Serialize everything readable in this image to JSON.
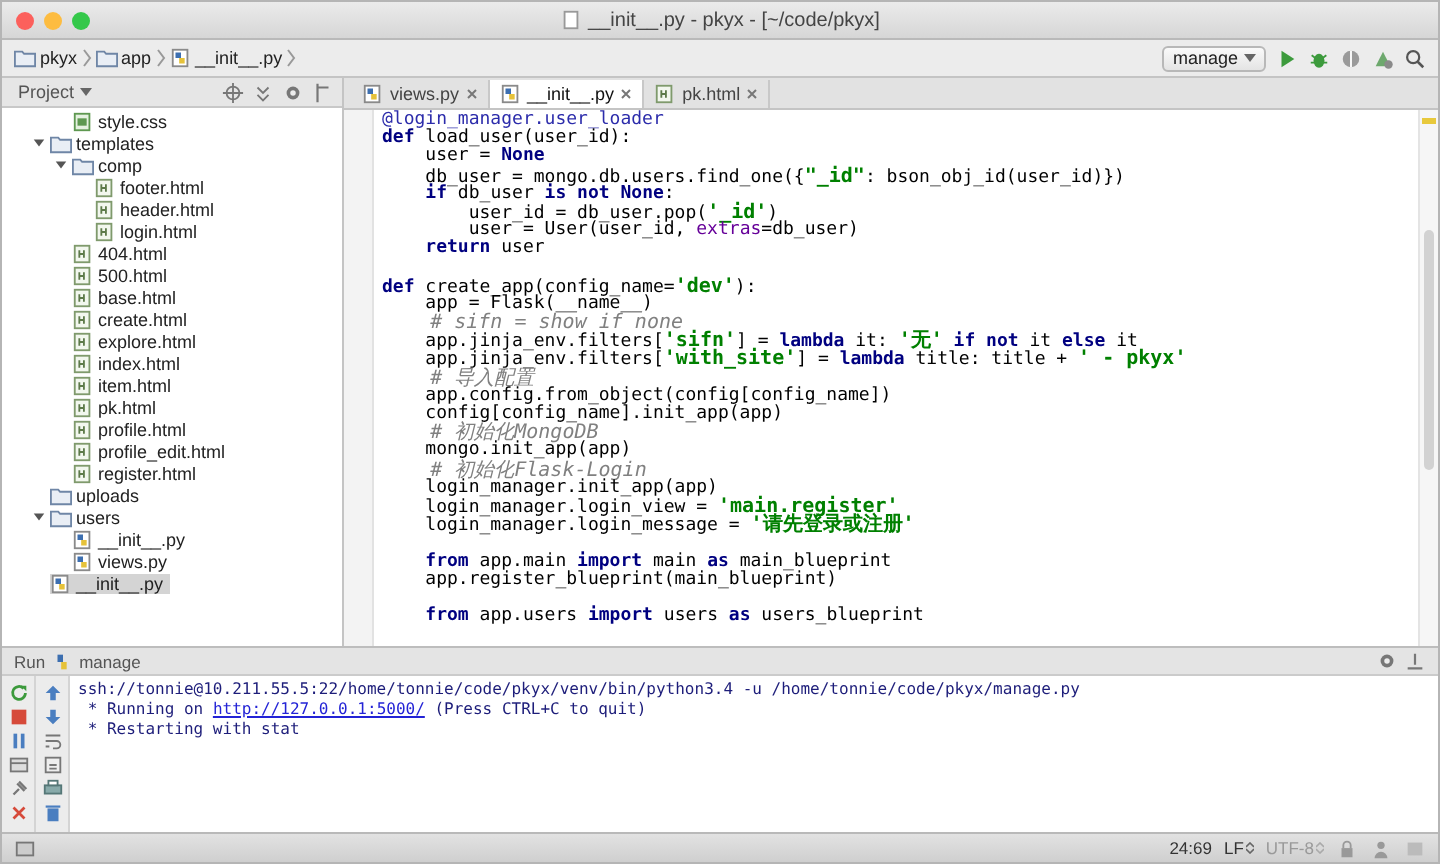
{
  "window": {
    "title": "__init__.py - pkyx - [~/code/pkyx]"
  },
  "breadcrumbs": [
    {
      "label": "pkyx",
      "kind": "folder"
    },
    {
      "label": "app",
      "kind": "folder"
    },
    {
      "label": "__init__.py",
      "kind": "py"
    }
  ],
  "run_config": {
    "label": "manage"
  },
  "project_panel": {
    "title": "Project",
    "tree": [
      {
        "children": [
          {
            "label": "style.css",
            "kind": "css",
            "selected": false
          }
        ]
      },
      {
        "label": "templates",
        "kind": "folder",
        "expanded": true,
        "selected": false,
        "children": [
          {
            "label": "comp",
            "kind": "folder",
            "expanded": true,
            "selected": false,
            "children": [
              {
                "label": "footer.html",
                "kind": "html",
                "selected": false
              },
              {
                "label": "header.html",
                "kind": "html",
                "selected": false
              },
              {
                "label": "login.html",
                "kind": "html",
                "selected": false
              }
            ]
          },
          {
            "label": "404.html",
            "kind": "html",
            "selected": false
          },
          {
            "label": "500.html",
            "kind": "html",
            "selected": false
          },
          {
            "label": "base.html",
            "kind": "html",
            "selected": false
          },
          {
            "label": "create.html",
            "kind": "html",
            "selected": false
          },
          {
            "label": "explore.html",
            "kind": "html",
            "selected": false
          },
          {
            "label": "index.html",
            "kind": "html",
            "selected": false
          },
          {
            "label": "item.html",
            "kind": "html",
            "selected": false
          },
          {
            "label": "pk.html",
            "kind": "html",
            "selected": false
          },
          {
            "label": "profile.html",
            "kind": "html",
            "selected": false
          },
          {
            "label": "profile_edit.html",
            "kind": "html",
            "selected": false
          },
          {
            "label": "register.html",
            "kind": "html",
            "selected": false
          }
        ]
      },
      {
        "label": "uploads",
        "kind": "folder",
        "selected": false
      },
      {
        "label": "users",
        "kind": "folder",
        "expanded": true,
        "selected": false,
        "children": [
          {
            "label": "__init__.py",
            "kind": "py",
            "selected": false
          },
          {
            "label": "views.py",
            "kind": "py",
            "selected": false
          }
        ]
      },
      {
        "label": "__init__.py",
        "kind": "py",
        "selected": true
      }
    ]
  },
  "editor_tabs": [
    {
      "label": "views.py",
      "kind": "py",
      "selected": false
    },
    {
      "label": "__init__.py",
      "kind": "py",
      "selected": true
    },
    {
      "label": "pk.html",
      "kind": "html",
      "selected": false
    }
  ],
  "code": [
    {
      "kind": "code",
      "tokens": [
        {
          "text": "@login_manager.user_loader",
          "kind": "deco"
        }
      ]
    },
    {
      "kind": "code",
      "tokens": [
        {
          "text": "def",
          "kind": "kw"
        },
        {
          "text": " load_user(user_id):",
          "kind": "plain"
        }
      ]
    },
    {
      "kind": "code",
      "tokens": [
        {
          "text": "    user = ",
          "kind": "plain"
        },
        {
          "text": "None",
          "kind": "kw"
        }
      ]
    },
    {
      "kind": "code",
      "tokens": [
        {
          "text": "    db_user = mongo.db.users.find_one({",
          "kind": "plain"
        },
        {
          "text": "\"_id\"",
          "kind": "str"
        },
        {
          "text": ": bson_obj_id(user_id)})",
          "kind": "plain"
        }
      ]
    },
    {
      "kind": "code",
      "tokens": [
        {
          "text": "    if",
          "kind": "kw"
        },
        {
          "text": " db_user ",
          "kind": "plain"
        },
        {
          "text": "is not None",
          "kind": "kw"
        },
        {
          "text": ":",
          "kind": "plain"
        }
      ]
    },
    {
      "kind": "code",
      "tokens": [
        {
          "text": "        user_id = db_user.pop(",
          "kind": "plain"
        },
        {
          "text": "'_id'",
          "kind": "str"
        },
        {
          "text": ")",
          "kind": "plain"
        }
      ]
    },
    {
      "kind": "code",
      "tokens": [
        {
          "text": "        user = User(user_id, ",
          "kind": "plain"
        },
        {
          "text": "extras",
          "kind": "param"
        },
        {
          "text": "=db_user)",
          "kind": "plain"
        }
      ]
    },
    {
      "kind": "code",
      "tokens": [
        {
          "text": "    return",
          "kind": "kw"
        },
        {
          "text": " user",
          "kind": "plain"
        }
      ]
    },
    {
      "kind": "blank"
    },
    {
      "kind": "code",
      "tokens": [
        {
          "text": "def",
          "kind": "kw"
        },
        {
          "text": " create_app(config_name=",
          "kind": "plain"
        },
        {
          "text": "'dev'",
          "kind": "str"
        },
        {
          "text": "):",
          "kind": "plain"
        }
      ]
    },
    {
      "kind": "code",
      "tokens": [
        {
          "text": "    app = Flask(__name__)",
          "kind": "plain"
        }
      ]
    },
    {
      "kind": "code",
      "tokens": [
        {
          "text": "    # sifn = show if none",
          "kind": "comment"
        }
      ]
    },
    {
      "kind": "code",
      "tokens": [
        {
          "text": "    app.jinja_env.filters[",
          "kind": "plain"
        },
        {
          "text": "'sifn'",
          "kind": "str"
        },
        {
          "text": "] = ",
          "kind": "plain"
        },
        {
          "text": "lambda",
          "kind": "kw"
        },
        {
          "text": " it: ",
          "kind": "plain"
        },
        {
          "text": "'无'",
          "kind": "str"
        },
        {
          "text": " if not",
          "kind": "kw"
        },
        {
          "text": " it ",
          "kind": "plain"
        },
        {
          "text": "else",
          "kind": "kw"
        },
        {
          "text": " it",
          "kind": "plain"
        }
      ]
    },
    {
      "kind": "code",
      "tokens": [
        {
          "text": "    app.jinja_env.filters[",
          "kind": "plain"
        },
        {
          "text": "'with_site'",
          "kind": "str"
        },
        {
          "text": "] = ",
          "kind": "plain"
        },
        {
          "text": "lambda",
          "kind": "kw"
        },
        {
          "text": " title: title + ",
          "kind": "plain"
        },
        {
          "text": "' - pkyx'",
          "kind": "str"
        }
      ]
    },
    {
      "kind": "code",
      "tokens": [
        {
          "text": "    # 导入配置",
          "kind": "comment"
        }
      ]
    },
    {
      "kind": "code",
      "tokens": [
        {
          "text": "    app.config.from_object(config[config_name])",
          "kind": "plain"
        }
      ]
    },
    {
      "kind": "code",
      "tokens": [
        {
          "text": "    config[config_name].init_app(app)",
          "kind": "plain"
        }
      ]
    },
    {
      "kind": "code",
      "tokens": [
        {
          "text": "    # 初始化MongoDB",
          "kind": "comment"
        }
      ]
    },
    {
      "kind": "code",
      "tokens": [
        {
          "text": "    mongo.init_app(app)",
          "kind": "plain"
        }
      ]
    },
    {
      "kind": "code",
      "tokens": [
        {
          "text": "    # 初始化Flask-Login",
          "kind": "comment"
        }
      ]
    },
    {
      "kind": "code",
      "tokens": [
        {
          "text": "    login_manager.init_app(app)",
          "kind": "plain"
        }
      ]
    },
    {
      "kind": "code",
      "tokens": [
        {
          "text": "    login_manager.login_view = ",
          "kind": "plain"
        },
        {
          "text": "'main.register'",
          "kind": "str"
        }
      ]
    },
    {
      "kind": "code",
      "tokens": [
        {
          "text": "    login_manager.login_message = ",
          "kind": "plain"
        },
        {
          "text": "'请先登录或注册'",
          "kind": "str"
        }
      ]
    },
    {
      "kind": "blank"
    },
    {
      "kind": "code",
      "tokens": [
        {
          "text": "    from",
          "kind": "kw"
        },
        {
          "text": " app.main ",
          "kind": "plain"
        },
        {
          "text": "import",
          "kind": "kw"
        },
        {
          "text": " main ",
          "kind": "plain"
        },
        {
          "text": "as",
          "kind": "kw"
        },
        {
          "text": " main_blueprint",
          "kind": "plain"
        }
      ]
    },
    {
      "kind": "code",
      "tokens": [
        {
          "text": "    app.register_blueprint(main_blueprint)",
          "kind": "plain"
        }
      ]
    },
    {
      "kind": "blank"
    },
    {
      "kind": "code",
      "tokens": [
        {
          "text": "    from",
          "kind": "kw"
        },
        {
          "text": " app.users ",
          "kind": "plain"
        },
        {
          "text": "import",
          "kind": "kw"
        },
        {
          "text": " users ",
          "kind": "plain"
        },
        {
          "text": "as",
          "kind": "kw"
        },
        {
          "text": " users_blueprint",
          "kind": "plain"
        }
      ]
    }
  ],
  "run_panel": {
    "title": "Run",
    "config": "manage",
    "console": [
      {
        "tokens": [
          {
            "text": "ssh://tonnie@10.211.55.5:22/home/tonnie/code/pkyx/venv/bin/python3.4 -u /home/tonnie/code/pkyx/manage.py",
            "kind": "text"
          }
        ]
      },
      {
        "tokens": [
          {
            "text": " * Running on ",
            "kind": "text"
          },
          {
            "text": "http://127.0.0.1:5000/",
            "kind": "link"
          },
          {
            "text": " (Press CTRL+C to quit)",
            "kind": "text"
          }
        ]
      },
      {
        "tokens": [
          {
            "text": " * Restarting with stat",
            "kind": "text"
          }
        ]
      }
    ]
  },
  "status_bar": {
    "position": "24:69",
    "line_separator": "LF",
    "encoding": "UTF-8"
  }
}
